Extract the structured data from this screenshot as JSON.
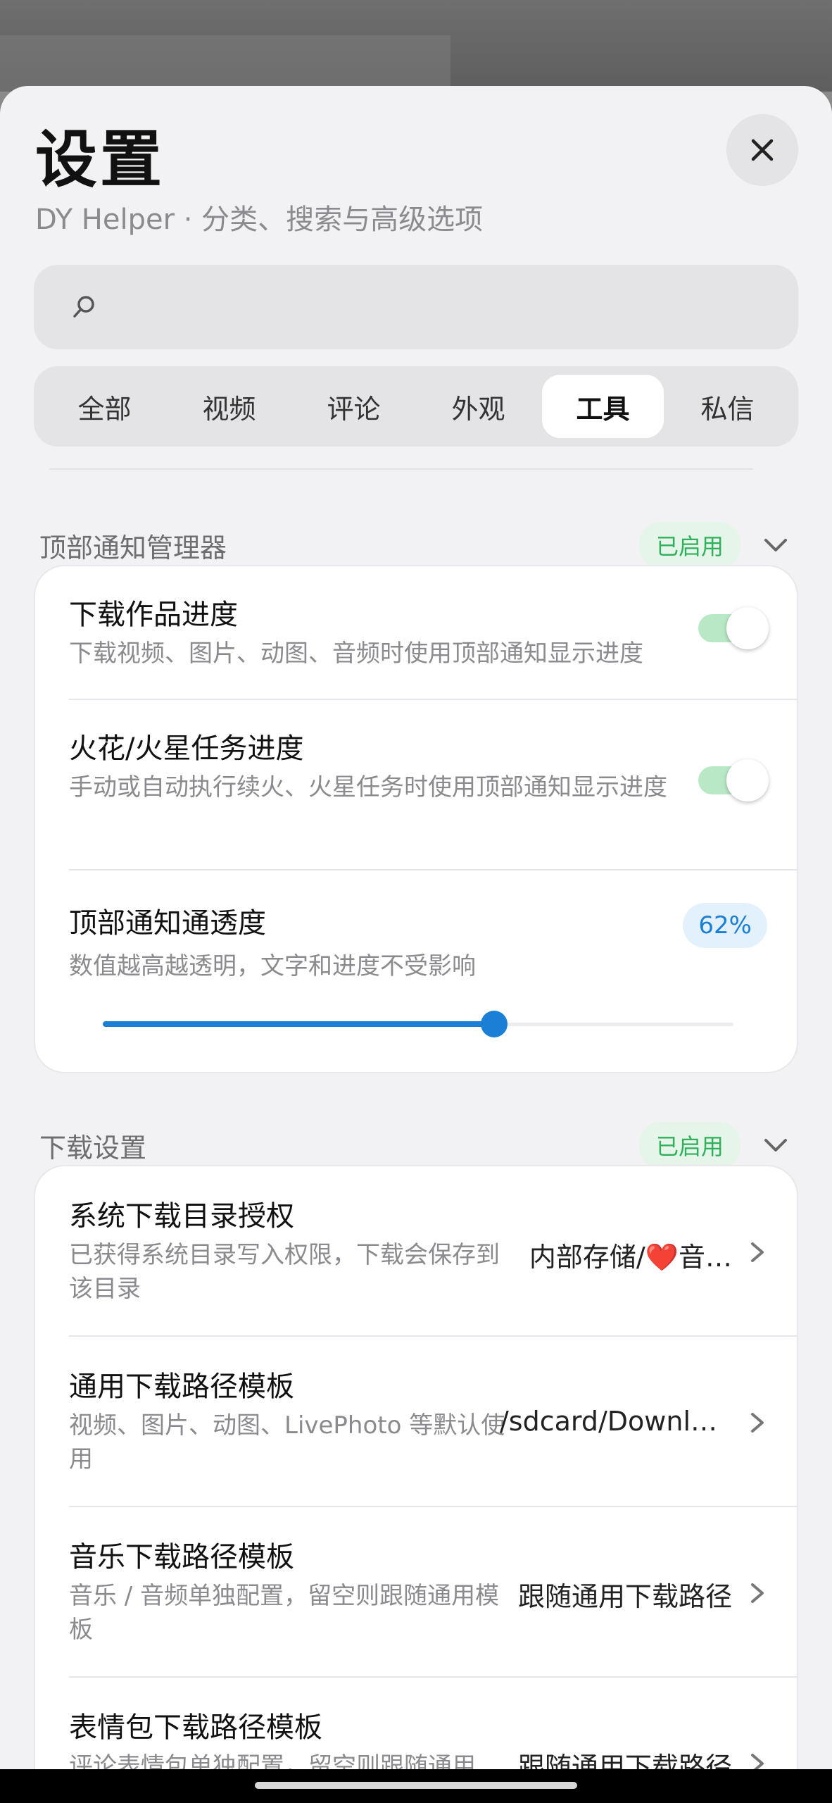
{
  "header": {
    "title": "设置",
    "subtitle": "DY Helper · 分类、搜索与高级选项",
    "close_icon": "close-icon"
  },
  "search": {
    "placeholder": "",
    "value": "",
    "icon": "search-icon"
  },
  "tabs": [
    {
      "label": "全部",
      "active": false
    },
    {
      "label": "视频",
      "active": false
    },
    {
      "label": "评论",
      "active": false
    },
    {
      "label": "外观",
      "active": false
    },
    {
      "label": "工具",
      "active": true
    },
    {
      "label": "私信",
      "active": false
    }
  ],
  "sections": [
    {
      "title": "顶部通知管理器",
      "badge": "已启用",
      "rows": [
        {
          "title": "下载作品进度",
          "desc": "下载视频、图片、动图、音频时使用顶部通知显示进度",
          "toggle_on": true
        },
        {
          "title": "火花/火星任务进度",
          "desc": "手动或自动执行续火、火星任务时使用顶部通知显示进度",
          "toggle_on": true
        },
        {
          "title": "顶部通知通透度",
          "desc": "数值越高越透明，文字和进度不受影响",
          "value": "62%",
          "slider_fraction": 0.62
        }
      ]
    },
    {
      "title": "下载设置",
      "badge": "已启用",
      "rows": [
        {
          "title": "系统下载目录授权",
          "desc": "已获得系统目录写入权限，下载会保存到该目录",
          "value": "内部存储/❤️音…"
        },
        {
          "title": "通用下载路径模板",
          "desc": "视频、图片、动图、LivePhoto 等默认使用",
          "value": "/sdcard/Downlo…"
        },
        {
          "title": "音乐下载路径模板",
          "desc": "音乐 / 音频单独配置，留空则跟随通用模板",
          "value": "跟随通用下载路径"
        },
        {
          "title": "表情包下载路径模板",
          "desc": "评论表情包单独配置，留空则跟随通用",
          "value": "跟随通用下载路径"
        }
      ]
    }
  ],
  "colors": {
    "accent_blue": "#1b7fd6",
    "enabled_green": "#2fb05a",
    "toggle_track": "#b9e8c6"
  }
}
